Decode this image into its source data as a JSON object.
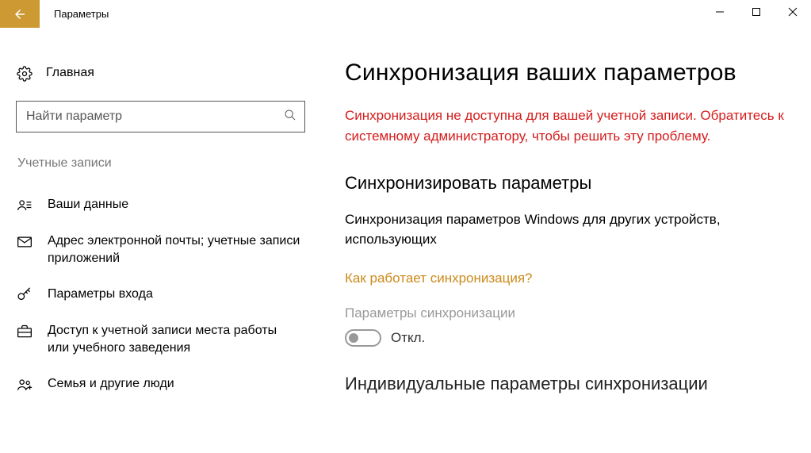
{
  "window": {
    "title": "Параметры"
  },
  "sidebar": {
    "home_label": "Главная",
    "search_placeholder": "Найти параметр",
    "category": "Учетные записи",
    "items": [
      {
        "label": "Ваши данные"
      },
      {
        "label": "Адрес электронной почты; учетные записи приложений"
      },
      {
        "label": "Параметры входа"
      },
      {
        "label": "Доступ к учетной записи места работы или учебного заведения"
      },
      {
        "label": "Семья и другие люди"
      }
    ]
  },
  "main": {
    "heading": "Синхронизация ваших параметров",
    "error": "Синхронизация не доступна для вашей учетной записи. Обратитесь к системному администратору, чтобы решить эту проблему.",
    "section_heading": "Синхронизировать параметры",
    "section_desc": "Синхронизация параметров Windows для других устройств, использующих",
    "link": "Как работает синхронизация?",
    "sync_settings_label": "Параметры синхронизации",
    "toggle_state": "Откл.",
    "next_heading": "Индивидуальные параметры синхронизации"
  }
}
